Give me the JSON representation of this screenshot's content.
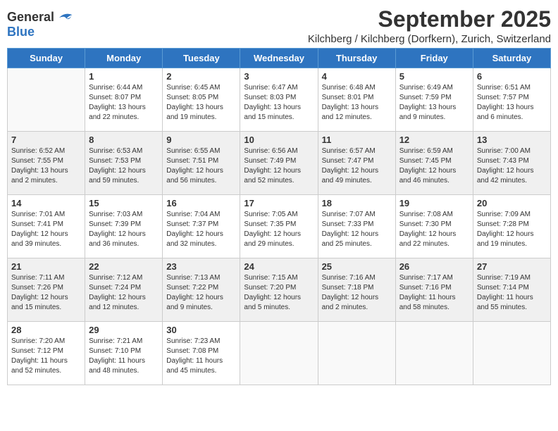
{
  "header": {
    "logo_general": "General",
    "logo_blue": "Blue",
    "title": "September 2025",
    "subtitle": "Kilchberg / Kilchberg (Dorfkern), Zurich, Switzerland"
  },
  "days_of_week": [
    "Sunday",
    "Monday",
    "Tuesday",
    "Wednesday",
    "Thursday",
    "Friday",
    "Saturday"
  ],
  "weeks": [
    {
      "shade": "white",
      "days": [
        {
          "number": "",
          "detail": ""
        },
        {
          "number": "1",
          "detail": "Sunrise: 6:44 AM\nSunset: 8:07 PM\nDaylight: 13 hours\nand 22 minutes."
        },
        {
          "number": "2",
          "detail": "Sunrise: 6:45 AM\nSunset: 8:05 PM\nDaylight: 13 hours\nand 19 minutes."
        },
        {
          "number": "3",
          "detail": "Sunrise: 6:47 AM\nSunset: 8:03 PM\nDaylight: 13 hours\nand 15 minutes."
        },
        {
          "number": "4",
          "detail": "Sunrise: 6:48 AM\nSunset: 8:01 PM\nDaylight: 13 hours\nand 12 minutes."
        },
        {
          "number": "5",
          "detail": "Sunrise: 6:49 AM\nSunset: 7:59 PM\nDaylight: 13 hours\nand 9 minutes."
        },
        {
          "number": "6",
          "detail": "Sunrise: 6:51 AM\nSunset: 7:57 PM\nDaylight: 13 hours\nand 6 minutes."
        }
      ]
    },
    {
      "shade": "shaded",
      "days": [
        {
          "number": "7",
          "detail": "Sunrise: 6:52 AM\nSunset: 7:55 PM\nDaylight: 13 hours\nand 2 minutes."
        },
        {
          "number": "8",
          "detail": "Sunrise: 6:53 AM\nSunset: 7:53 PM\nDaylight: 12 hours\nand 59 minutes."
        },
        {
          "number": "9",
          "detail": "Sunrise: 6:55 AM\nSunset: 7:51 PM\nDaylight: 12 hours\nand 56 minutes."
        },
        {
          "number": "10",
          "detail": "Sunrise: 6:56 AM\nSunset: 7:49 PM\nDaylight: 12 hours\nand 52 minutes."
        },
        {
          "number": "11",
          "detail": "Sunrise: 6:57 AM\nSunset: 7:47 PM\nDaylight: 12 hours\nand 49 minutes."
        },
        {
          "number": "12",
          "detail": "Sunrise: 6:59 AM\nSunset: 7:45 PM\nDaylight: 12 hours\nand 46 minutes."
        },
        {
          "number": "13",
          "detail": "Sunrise: 7:00 AM\nSunset: 7:43 PM\nDaylight: 12 hours\nand 42 minutes."
        }
      ]
    },
    {
      "shade": "white",
      "days": [
        {
          "number": "14",
          "detail": "Sunrise: 7:01 AM\nSunset: 7:41 PM\nDaylight: 12 hours\nand 39 minutes."
        },
        {
          "number": "15",
          "detail": "Sunrise: 7:03 AM\nSunset: 7:39 PM\nDaylight: 12 hours\nand 36 minutes."
        },
        {
          "number": "16",
          "detail": "Sunrise: 7:04 AM\nSunset: 7:37 PM\nDaylight: 12 hours\nand 32 minutes."
        },
        {
          "number": "17",
          "detail": "Sunrise: 7:05 AM\nSunset: 7:35 PM\nDaylight: 12 hours\nand 29 minutes."
        },
        {
          "number": "18",
          "detail": "Sunrise: 7:07 AM\nSunset: 7:33 PM\nDaylight: 12 hours\nand 25 minutes."
        },
        {
          "number": "19",
          "detail": "Sunrise: 7:08 AM\nSunset: 7:30 PM\nDaylight: 12 hours\nand 22 minutes."
        },
        {
          "number": "20",
          "detail": "Sunrise: 7:09 AM\nSunset: 7:28 PM\nDaylight: 12 hours\nand 19 minutes."
        }
      ]
    },
    {
      "shade": "shaded",
      "days": [
        {
          "number": "21",
          "detail": "Sunrise: 7:11 AM\nSunset: 7:26 PM\nDaylight: 12 hours\nand 15 minutes."
        },
        {
          "number": "22",
          "detail": "Sunrise: 7:12 AM\nSunset: 7:24 PM\nDaylight: 12 hours\nand 12 minutes."
        },
        {
          "number": "23",
          "detail": "Sunrise: 7:13 AM\nSunset: 7:22 PM\nDaylight: 12 hours\nand 9 minutes."
        },
        {
          "number": "24",
          "detail": "Sunrise: 7:15 AM\nSunset: 7:20 PM\nDaylight: 12 hours\nand 5 minutes."
        },
        {
          "number": "25",
          "detail": "Sunrise: 7:16 AM\nSunset: 7:18 PM\nDaylight: 12 hours\nand 2 minutes."
        },
        {
          "number": "26",
          "detail": "Sunrise: 7:17 AM\nSunset: 7:16 PM\nDaylight: 11 hours\nand 58 minutes."
        },
        {
          "number": "27",
          "detail": "Sunrise: 7:19 AM\nSunset: 7:14 PM\nDaylight: 11 hours\nand 55 minutes."
        }
      ]
    },
    {
      "shade": "white",
      "days": [
        {
          "number": "28",
          "detail": "Sunrise: 7:20 AM\nSunset: 7:12 PM\nDaylight: 11 hours\nand 52 minutes."
        },
        {
          "number": "29",
          "detail": "Sunrise: 7:21 AM\nSunset: 7:10 PM\nDaylight: 11 hours\nand 48 minutes."
        },
        {
          "number": "30",
          "detail": "Sunrise: 7:23 AM\nSunset: 7:08 PM\nDaylight: 11 hours\nand 45 minutes."
        },
        {
          "number": "",
          "detail": ""
        },
        {
          "number": "",
          "detail": ""
        },
        {
          "number": "",
          "detail": ""
        },
        {
          "number": "",
          "detail": ""
        }
      ]
    }
  ]
}
